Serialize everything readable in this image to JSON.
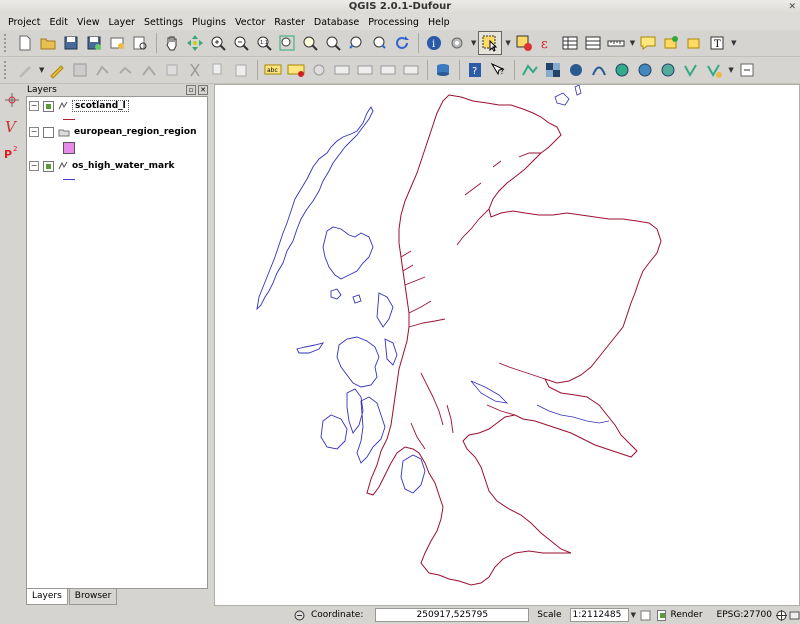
{
  "window": {
    "title": "QGIS 2.0.1-Dufour"
  },
  "menu": [
    "Project",
    "Edit",
    "View",
    "Layer",
    "Settings",
    "Plugins",
    "Vector",
    "Raster",
    "Database",
    "Processing",
    "Help"
  ],
  "layers_panel": {
    "title": "Layers",
    "layers": [
      {
        "name": "scotland_l",
        "checked": true,
        "expanded": true,
        "selected": true,
        "type": "line",
        "color": "#b02030"
      },
      {
        "name": "european_region_region",
        "checked": false,
        "expanded": true,
        "selected": false,
        "type": "polygon",
        "color": "#e88ae8"
      },
      {
        "name": "os_high_water_mark",
        "checked": true,
        "expanded": true,
        "selected": false,
        "type": "line",
        "color": "#4040c0"
      }
    ],
    "tabs": [
      "Layers",
      "Browser"
    ],
    "active_tab": "Layers"
  },
  "left_strip_icons": [
    "digitize-icon",
    "vector-v-icon",
    "p2-icon"
  ],
  "status": {
    "coordinate_label": "Coordinate:",
    "coordinate_value": "250917,525795",
    "scale_label": "Scale",
    "scale_value": "1:2112485",
    "render_label": "Render",
    "render_checked": true,
    "crs": "EPSG:27700"
  },
  "colors": {
    "coast_red": "#9a1030",
    "coast_blue": "#3333bb"
  }
}
